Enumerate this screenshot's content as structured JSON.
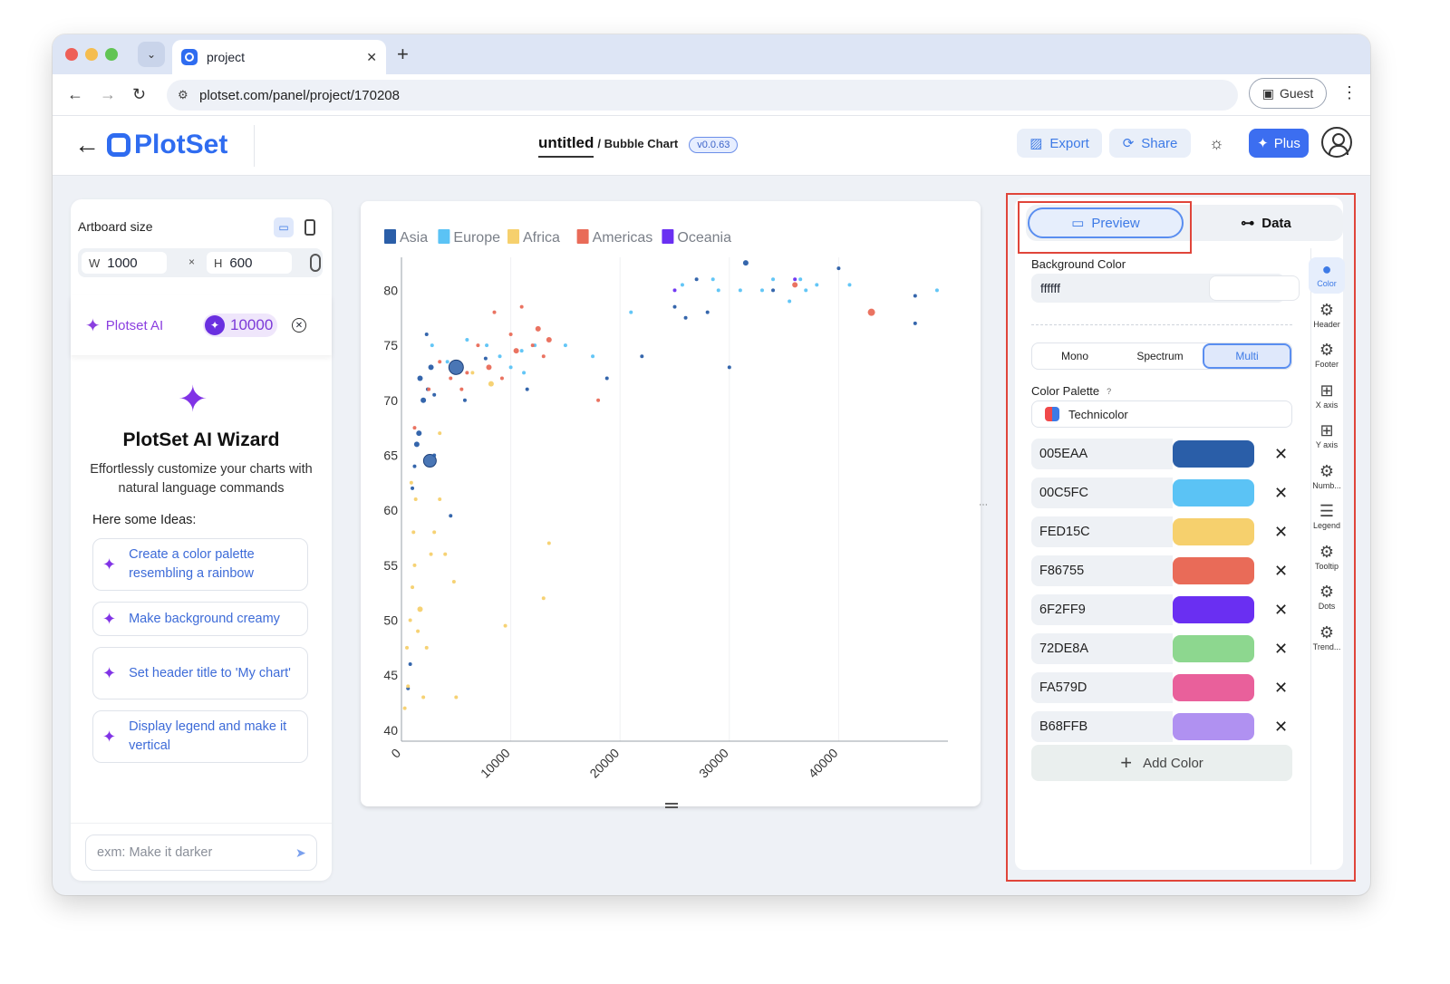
{
  "browser": {
    "tab_title": "project",
    "url": "plotset.com/panel/project/170208",
    "guest_label": "Guest"
  },
  "app": {
    "logo_text": "PlotSet",
    "project_title": "untitled",
    "chart_type": "/ Bubble Chart",
    "version": "v0.0.63",
    "export_label": "Export",
    "share_label": "Share",
    "plus_label": "Plus"
  },
  "left_panel": {
    "artboard_label": "Artboard size",
    "width_label": "W",
    "width_value": "1000",
    "height_label": "H",
    "height_value": "600",
    "times": "×",
    "ai_label": "Plotset AI",
    "credits": "10000",
    "wizard_title": "PlotSet AI Wizard",
    "wizard_sub": "Effortlessly customize your charts with natural language commands",
    "ideas_label": "Here some Ideas:",
    "ideas": [
      "Create a color palette resembling a rainbow",
      "Make background creamy",
      "Set header title to 'My chart'",
      "Display legend and make it vertical"
    ],
    "prompt_placeholder": "exm: Make it darker"
  },
  "right_panel": {
    "preview_label": "Preview",
    "data_label": "Data",
    "bg_label": "Background Color",
    "bg_value": "ffffff",
    "modes": [
      "Mono",
      "Spectrum",
      "Multi"
    ],
    "active_mode": "Multi",
    "palette_label": "Color Palette",
    "palette_help": "?",
    "palette_name": "Technicolor",
    "colors": [
      {
        "hex": "005EAA",
        "color": "#2a5ea8"
      },
      {
        "hex": "00C5FC",
        "color": "#5bc3f5"
      },
      {
        "hex": "FED15C",
        "color": "#f6d06d"
      },
      {
        "hex": "F86755",
        "color": "#e96b58"
      },
      {
        "hex": "6F2FF9",
        "color": "#6a2ff2"
      },
      {
        "hex": "72DE8A",
        "color": "#8dd78f"
      },
      {
        "hex": "FA579D",
        "color": "#e9609b"
      },
      {
        "hex": "B68FFB",
        "color": "#b091f1"
      }
    ],
    "add_color_label": "Add Color",
    "side_tabs": [
      {
        "label": "Color",
        "icon": "palette-icon"
      },
      {
        "label": "Header",
        "icon": "gear-icon"
      },
      {
        "label": "Footer",
        "icon": "gear-icon"
      },
      {
        "label": "X axis",
        "icon": "grid-icon"
      },
      {
        "label": "Y axis",
        "icon": "grid-icon"
      },
      {
        "label": "Numb...",
        "icon": "gear-icon"
      },
      {
        "label": "Legend",
        "icon": "legend-icon"
      },
      {
        "label": "Tooltip",
        "icon": "gear-icon"
      },
      {
        "label": "Dots",
        "icon": "gear-icon"
      },
      {
        "label": "Trend...",
        "icon": "gear-icon"
      }
    ]
  },
  "chart_data": {
    "type": "scatter",
    "title": "",
    "xlabel": "",
    "ylabel": "",
    "xlim": [
      0,
      50000
    ],
    "ylim": [
      39,
      83
    ],
    "x_ticks": [
      0,
      10000,
      20000,
      30000,
      40000
    ],
    "y_ticks": [
      40,
      45,
      50,
      55,
      60,
      65,
      70,
      75,
      80
    ],
    "legend_position": "top-left",
    "series": [
      {
        "name": "Asia",
        "color": "#2a5ea8",
        "points": [
          [
            600,
            43.8
          ],
          [
            800,
            46
          ],
          [
            1000,
            62
          ],
          [
            1200,
            64
          ],
          [
            1400,
            66
          ],
          [
            1600,
            67
          ],
          [
            1700,
            72
          ],
          [
            2000,
            70
          ],
          [
            2300,
            76
          ],
          [
            2400,
            71
          ],
          [
            2700,
            73
          ],
          [
            2600,
            64.5
          ],
          [
            3000,
            70.5
          ],
          [
            3000,
            65
          ],
          [
            4500,
            59.5
          ],
          [
            5000,
            73
          ],
          [
            5800,
            70
          ],
          [
            7700,
            73.8
          ],
          [
            11500,
            71
          ],
          [
            18800,
            72
          ],
          [
            22000,
            74
          ],
          [
            25000,
            78.5
          ],
          [
            26000,
            77.5
          ],
          [
            27000,
            81
          ],
          [
            28000,
            78
          ],
          [
            30000,
            73
          ],
          [
            31500,
            82.5
          ],
          [
            34000,
            80
          ],
          [
            40000,
            82
          ],
          [
            47000,
            79.5
          ],
          [
            47000,
            77
          ]
        ],
        "sizes": [
          2,
          2,
          2,
          2,
          3,
          3,
          3,
          3,
          2,
          2,
          3,
          7,
          2,
          2,
          2,
          8,
          2,
          2,
          2,
          2,
          2,
          2,
          2,
          2,
          2,
          2,
          3,
          2,
          2,
          2,
          2
        ]
      },
      {
        "name": "Europe",
        "color": "#5bc3f5",
        "points": [
          [
            2800,
            75
          ],
          [
            4200,
            73.5
          ],
          [
            6000,
            75.5
          ],
          [
            7800,
            75
          ],
          [
            9000,
            74
          ],
          [
            10000,
            73
          ],
          [
            11000,
            74.5
          ],
          [
            11200,
            72.5
          ],
          [
            12200,
            75
          ],
          [
            15000,
            75
          ],
          [
            17500,
            74
          ],
          [
            21000,
            78
          ],
          [
            25700,
            80.5
          ],
          [
            28500,
            81
          ],
          [
            29000,
            80
          ],
          [
            31000,
            80
          ],
          [
            33000,
            80
          ],
          [
            34000,
            81
          ],
          [
            35500,
            79
          ],
          [
            36500,
            81
          ],
          [
            37000,
            80
          ],
          [
            38000,
            80.5
          ],
          [
            41000,
            80.5
          ],
          [
            49000,
            80
          ]
        ],
        "sizes": [
          2,
          2,
          2,
          2,
          2,
          2,
          2,
          2,
          2,
          2,
          2,
          2,
          2,
          2,
          2,
          2,
          2,
          2,
          2,
          2,
          2,
          2,
          2,
          2
        ]
      },
      {
        "name": "Africa",
        "color": "#f6d06d",
        "points": [
          [
            300,
            42
          ],
          [
            500,
            47.5
          ],
          [
            600,
            44
          ],
          [
            800,
            50
          ],
          [
            1000,
            53
          ],
          [
            1200,
            55
          ],
          [
            1500,
            49
          ],
          [
            1700,
            51
          ],
          [
            2000,
            43
          ],
          [
            2300,
            47.5
          ],
          [
            2700,
            56
          ],
          [
            3000,
            58
          ],
          [
            3500,
            61
          ],
          [
            4000,
            56
          ],
          [
            4800,
            53.5
          ],
          [
            5000,
            43
          ],
          [
            9500,
            49.5
          ],
          [
            13000,
            52
          ],
          [
            3500,
            67
          ],
          [
            6500,
            72.5
          ],
          [
            8200,
            71.5
          ],
          [
            1300,
            61
          ],
          [
            1100,
            58
          ],
          [
            900,
            62.5
          ],
          [
            13500,
            57
          ]
        ],
        "sizes": [
          2,
          2,
          2,
          2,
          2,
          2,
          2,
          3,
          2,
          2,
          2,
          2,
          2,
          2,
          2,
          2,
          2,
          2,
          2,
          2,
          3,
          2,
          2,
          2,
          2
        ]
      },
      {
        "name": "Americas",
        "color": "#e96b58",
        "points": [
          [
            1200,
            67.5
          ],
          [
            2500,
            71
          ],
          [
            3500,
            73.5
          ],
          [
            4500,
            72
          ],
          [
            5500,
            71
          ],
          [
            6000,
            72.5
          ],
          [
            7000,
            75
          ],
          [
            8000,
            73
          ],
          [
            8500,
            78
          ],
          [
            9200,
            72
          ],
          [
            10000,
            76
          ],
          [
            10500,
            74.5
          ],
          [
            11000,
            78.5
          ],
          [
            12000,
            75
          ],
          [
            12500,
            76.5
          ],
          [
            13000,
            74
          ],
          [
            13500,
            75.5
          ],
          [
            18000,
            70
          ],
          [
            36000,
            80.5
          ],
          [
            43000,
            78
          ]
        ],
        "sizes": [
          2,
          2,
          2,
          2,
          2,
          2,
          2,
          3,
          2,
          2,
          2,
          3,
          2,
          2,
          3,
          2,
          3,
          2,
          3,
          4
        ]
      },
      {
        "name": "Oceania",
        "color": "#6a2ff2",
        "points": [
          [
            25000,
            80
          ],
          [
            36000,
            81
          ]
        ],
        "sizes": [
          2,
          2
        ]
      }
    ]
  }
}
